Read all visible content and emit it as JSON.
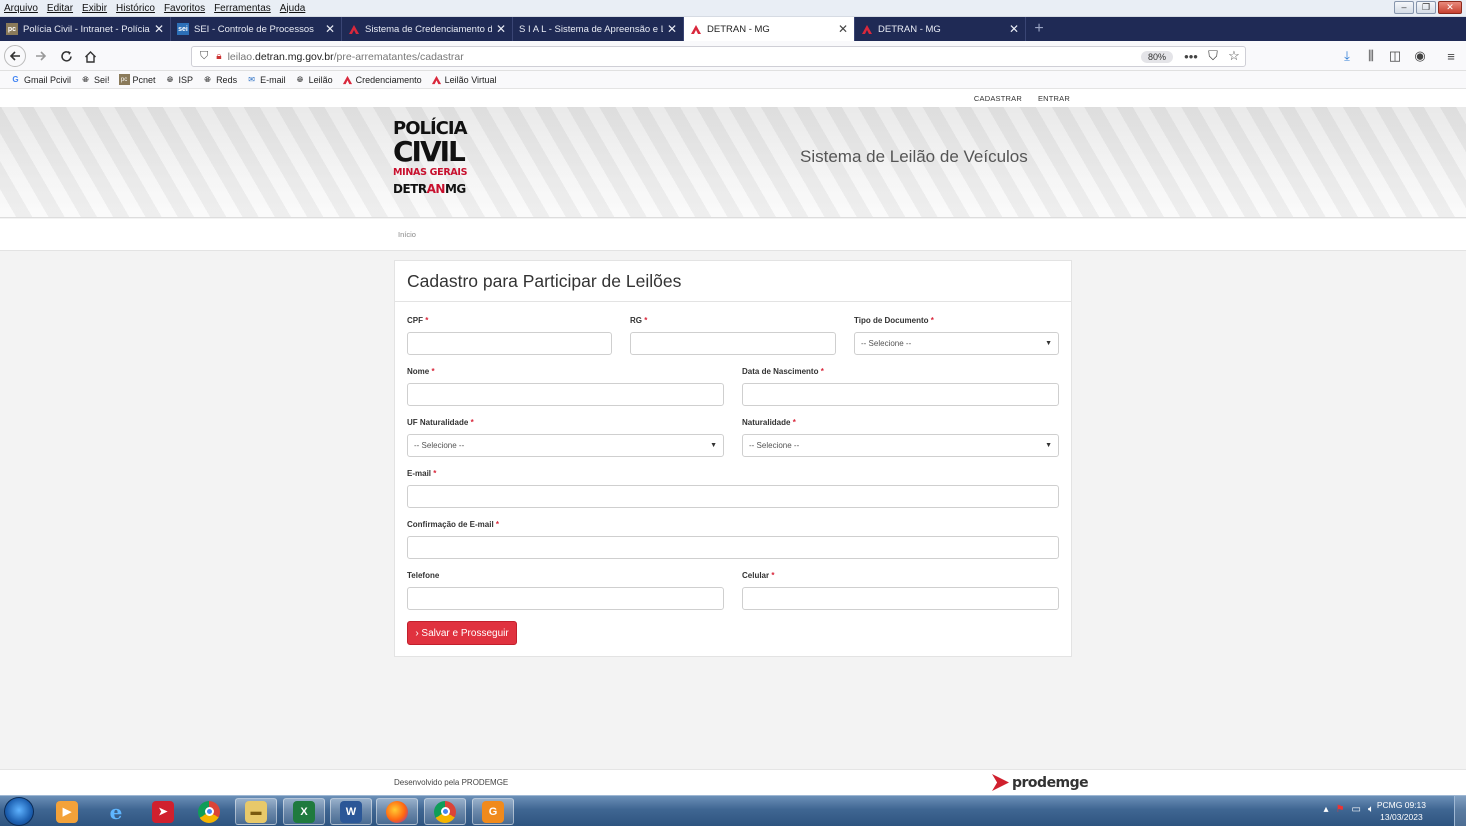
{
  "menubar": {
    "items": [
      "Arquivo",
      "Editar",
      "Exibir",
      "Histórico",
      "Favoritos",
      "Ferramentas",
      "Ajuda"
    ]
  },
  "tabs": [
    {
      "label": "Polícia Civil - Intranet - Polícia",
      "icon": "pc-icon"
    },
    {
      "label": "SEI - Controle de Processos",
      "icon": "sei-icon"
    },
    {
      "label": "Sistema de Credenciamento de",
      "icon": "detran-icon"
    },
    {
      "label": "S I A L - Sistema de Apreensão e Le",
      "icon": "detran-icon"
    },
    {
      "label": "DETRAN - MG",
      "icon": "detran-icon",
      "active": true
    },
    {
      "label": "DETRAN - MG",
      "icon": "detran-icon"
    }
  ],
  "url": {
    "host_prefix": "leilao.",
    "host": "detran.mg.gov.br",
    "path": "/pre-arrematantes/cadastrar",
    "zoom": "80%"
  },
  "bookmarks": [
    {
      "label": "Gmail Pcivil",
      "icon": "google-icon"
    },
    {
      "label": "Sei!",
      "icon": "globe-icon"
    },
    {
      "label": "Pcnet",
      "icon": "pc-icon"
    },
    {
      "label": "ISP",
      "icon": "globe-icon"
    },
    {
      "label": "Reds",
      "icon": "globe-icon"
    },
    {
      "label": "E-mail",
      "icon": "mail-icon"
    },
    {
      "label": "Leilão",
      "icon": "globe-icon"
    },
    {
      "label": "Credenciamento",
      "icon": "detran-icon"
    },
    {
      "label": "Leilão Virtual",
      "icon": "detran-icon"
    }
  ],
  "topnav": {
    "cadastrar": "CADASTRAR",
    "entrar": "ENTRAR"
  },
  "logo": {
    "line1": "POLÍCIA",
    "line2": "CIVIL",
    "line3": "MINAS GERAIS",
    "line4a": "DETR",
    "line4b": "AN",
    "line4c": "MG"
  },
  "system_title": "Sistema de Leilão de Veículos",
  "breadcrumb": "Início",
  "form": {
    "title": "Cadastro para Participar de Leilões",
    "cpf": "CPF",
    "rg": "RG",
    "tipo_documento": "Tipo de Documento",
    "nome": "Nome",
    "data_nascimento": "Data de Nascimento",
    "uf_naturalidade": "UF Naturalidade",
    "naturalidade": "Naturalidade",
    "email": "E-mail",
    "confirmacao_email": "Confirmação de E-mail",
    "telefone": "Telefone",
    "celular": "Celular",
    "required_mark": "*",
    "select_placeholder": "-- Selecione --",
    "submit": "› Salvar e Prosseguir"
  },
  "footer": {
    "text": "Desenvolvido pela PRODEMGE",
    "brand": "prodemge"
  },
  "tray": {
    "host": "PCMG 09:13",
    "date": "13/03/2023"
  },
  "colors": {
    "accent": "#e0323f",
    "tabbar": "#1f2a55",
    "detran_red": "#c8102e"
  }
}
